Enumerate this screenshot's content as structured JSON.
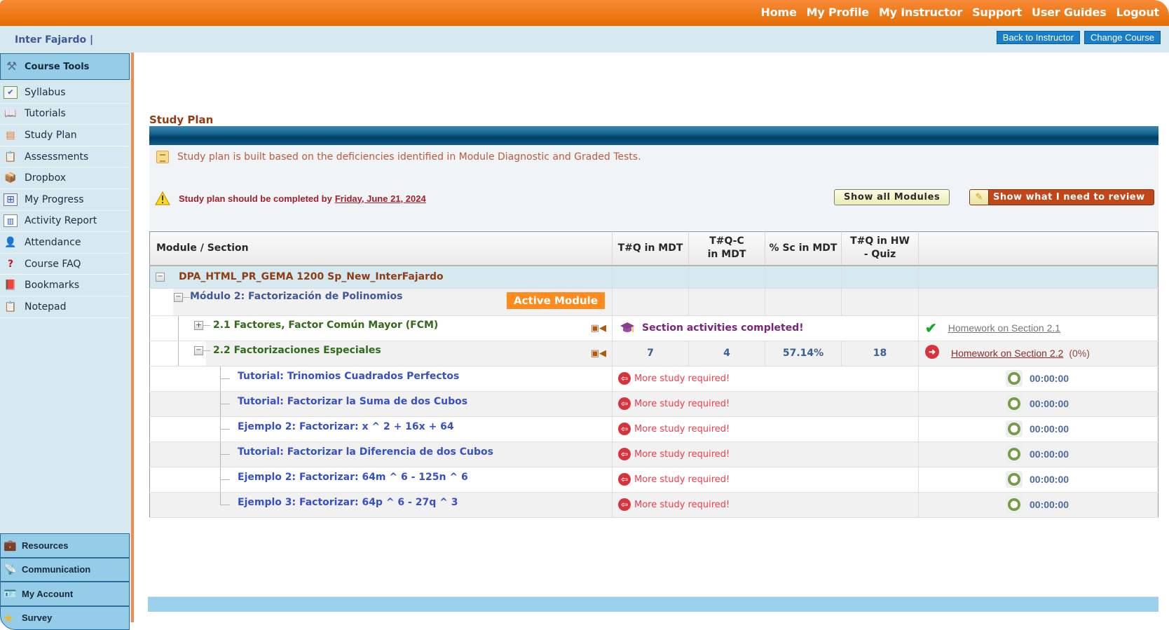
{
  "topnav": [
    "Home",
    "My Profile",
    "My Instructor",
    "Support",
    "User Guides",
    "Logout"
  ],
  "institution": "Inter Fajardo |",
  "subbar_buttons": [
    "Back to Instructor",
    "Change Course"
  ],
  "sidebar": {
    "header": "Course Tools",
    "items": [
      {
        "label": "Syllabus",
        "icon": "calendar-check-icon"
      },
      {
        "label": "Tutorials",
        "icon": "book-icon"
      },
      {
        "label": "Study Plan",
        "icon": "document-icon"
      },
      {
        "label": "Assessments",
        "icon": "clipboard-icon"
      },
      {
        "label": "Dropbox",
        "icon": "box-icon"
      },
      {
        "label": "My Progress",
        "icon": "progress-icon"
      },
      {
        "label": "Activity Report",
        "icon": "bar-chart-icon"
      },
      {
        "label": "Attendance",
        "icon": "user-check-icon"
      },
      {
        "label": "Course FAQ",
        "icon": "question-icon"
      },
      {
        "label": "Bookmarks",
        "icon": "bookmark-book-icon"
      },
      {
        "label": "Notepad",
        "icon": "notepad-icon"
      }
    ],
    "bottom": [
      {
        "label": "Resources",
        "icon": "briefcase-icon"
      },
      {
        "label": "Communication",
        "icon": "broadcast-icon"
      },
      {
        "label": "My Account",
        "icon": "id-card-icon"
      },
      {
        "label": "Survey",
        "icon": "star-document-icon"
      }
    ]
  },
  "main": {
    "title": "Study Plan",
    "note": "Study plan is built based on the deficiencies identified in Module Diagnostic and Graded Tests.",
    "warning_prefix": "Study plan should be completed by",
    "warning_date": "Friday, June 21, 2024",
    "show_all_modules": "Show all Modules",
    "show_review": "Show what I need to review"
  },
  "table": {
    "headers": [
      "Module / Section",
      "T#Q in MDT",
      "T#Q-C in MDT",
      "% Sc in MDT",
      "T#Q in HW - Quiz",
      ""
    ],
    "course": "DPA_HTML_PR_GEMA 1200 Sp_New_InterFajardo",
    "module": "Módulo 2: Factorización de Polinomios",
    "active_module": "Active Module",
    "sections": [
      {
        "name": "2.1 Factores, Factor Común Mayor (FCM)",
        "status": "Section activities completed!",
        "homework": "Homework on Section 2.1",
        "hw_done": true
      },
      {
        "name": "2.2 Factorizaciones Especiales",
        "tq_mdt": "7",
        "tqc_mdt": "4",
        "sc_mdt": "57.14%",
        "tq_hw": "18",
        "homework": "Homework on Section 2.2",
        "hw_pct": "(0%)",
        "hw_done": false
      }
    ],
    "items": [
      {
        "name": "Tutorial: Trinomios Cuadrados Perfectos",
        "status": "More study required!",
        "time": "00:00:00"
      },
      {
        "name": "Tutorial: Factorizar la Suma de dos Cubos",
        "status": "More study required!",
        "time": "00:00:00"
      },
      {
        "name": "Ejemplo 2: Factorizar: x ^ 2 + 16x + 64",
        "status": "More study required!",
        "time": "00:00:00"
      },
      {
        "name": "Tutorial: Factorizar la Diferencia de dos Cubos",
        "status": "More study required!",
        "time": "00:00:00"
      },
      {
        "name": "Ejemplo 2: Factorizar: 64m ^ 6 - 125n ^ 6",
        "status": "More study required!",
        "time": "00:00:00"
      },
      {
        "name": "Ejemplo 3: Factorizar: 64p ^ 6 - 27q ^ 3",
        "status": "More study required!",
        "time": "00:00:00"
      }
    ]
  }
}
